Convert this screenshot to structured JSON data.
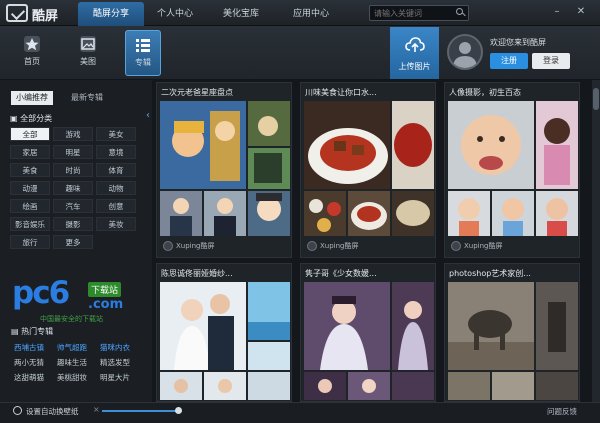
{
  "app": {
    "title": "酷屏"
  },
  "nav": {
    "tabs": [
      {
        "label": "酷屏分享",
        "active": true
      },
      {
        "label": "个人中心",
        "active": false
      },
      {
        "label": "美化宝库",
        "active": false
      },
      {
        "label": "应用中心",
        "active": false
      }
    ]
  },
  "search": {
    "placeholder": "请输入关键词"
  },
  "window": {
    "minimize": "–",
    "close": "✕"
  },
  "toolbar": {
    "items": [
      {
        "label": "首页",
        "icon": "star-icon"
      },
      {
        "label": "美图",
        "icon": "image-icon"
      },
      {
        "label": "专辑",
        "icon": "grid-list-icon",
        "active": true
      }
    ]
  },
  "upload": {
    "label": "上传图片"
  },
  "user": {
    "welcome": "欢迎您来到酷屏",
    "register": "注册",
    "login": "登录"
  },
  "sidebar": {
    "subtabs": [
      "小编推荐",
      "最新专辑"
    ],
    "all_categories_title": "全部分类",
    "categories": [
      "全部",
      "游戏",
      "美女",
      "家居",
      "明星",
      "意境",
      "美食",
      "时尚",
      "体育",
      "动漫",
      "趣味",
      "动物",
      "绘画",
      "汽车",
      "创意",
      "影音娱乐",
      "摄影",
      "美妆",
      "旅行",
      "更多"
    ],
    "selected_category": "全部",
    "hot_title": "热门专辑",
    "hot_albums": [
      {
        "label": "西埔古镇",
        "color": "#4aa3ff"
      },
      {
        "label": "帅气超跑",
        "color": "#4aa3ff"
      },
      {
        "label": "猫咪内衣",
        "color": "#4aa3ff"
      },
      {
        "label": "两小无猜",
        "color": "#c3ccd4"
      },
      {
        "label": "趣味生活",
        "color": "#c3ccd4"
      },
      {
        "label": "精选发型",
        "color": "#c3ccd4"
      },
      {
        "label": "这甜萌猫",
        "color": "#c3ccd4"
      },
      {
        "label": "美桃甜妆",
        "color": "#c3ccd4"
      },
      {
        "label": "明星大片",
        "color": "#c3ccd4"
      }
    ],
    "watermark": {
      "main": "pc6",
      "badge": "下载站",
      "com": ".com",
      "sub": "中国最安全的下载站"
    }
  },
  "albums": [
    {
      "title": "二次元老爸星座盘点",
      "author": "Xuping酷屏"
    },
    {
      "title": "川味美食让你口水...",
      "author": "Xuping酷屏"
    },
    {
      "title": "人像摄影，初生百态",
      "author": "Xuping酷屏"
    },
    {
      "title": "陈思诚佟丽娅婚纱...",
      "author": ""
    },
    {
      "title": "隽子哥《少女数媛...",
      "author": ""
    },
    {
      "title": "photoshop艺术家创...",
      "author": ""
    }
  ],
  "bottom": {
    "wallpaper_label": "设置自动换壁纸",
    "feedback": "问题反馈",
    "slider_min": "×",
    "slider_level": 0.95
  }
}
